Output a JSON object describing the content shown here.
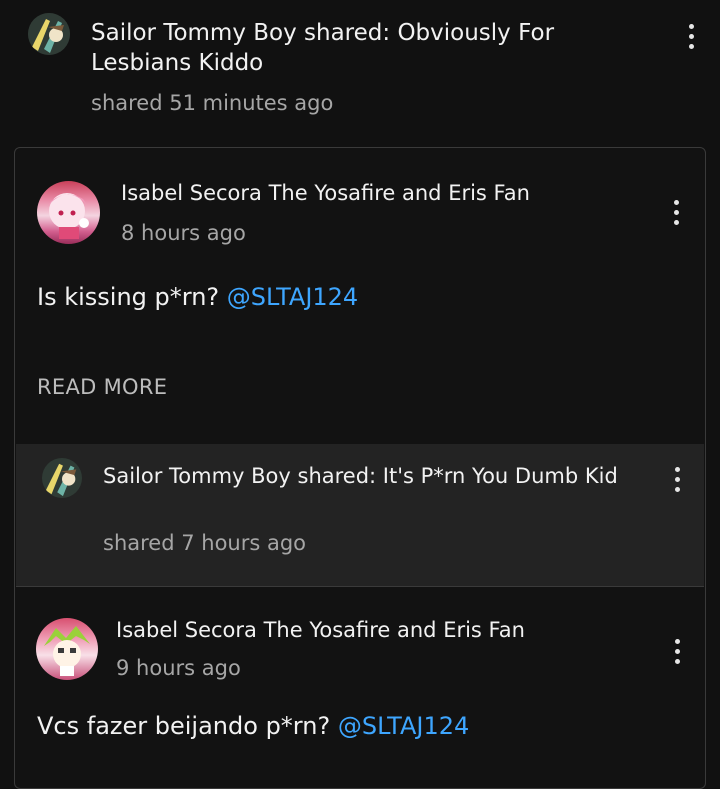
{
  "top_post": {
    "title": "Sailor Tommy Boy shared: Obviously For Lesbians Kiddo",
    "meta": "shared 51 minutes ago",
    "avatar_icon": "character-avatar-icon",
    "menu_icon": "more-vert-icon"
  },
  "comment": {
    "author": "Isabel Secora The Yosafire and Eris Fan",
    "time": "8 hours ago",
    "text": "Is kissing p*rn? ",
    "mention": "@SLTAJ124",
    "read_more": "READ MORE",
    "avatar_icon": "pink-character-avatar-icon"
  },
  "shared_post": {
    "title": "Sailor Tommy Boy shared: It's P*rn You Dumb Kid",
    "meta": "shared 7 hours ago",
    "avatar_icon": "character-avatar-icon"
  },
  "comment2": {
    "author": "Isabel Secora The Yosafire and Eris Fan",
    "time": "9 hours ago",
    "partial_text": "Vcs fazer beijando p*rn?",
    "partial_mention": "@SLTAJ124",
    "avatar_icon": "green-haired-avatar-icon"
  },
  "colors": {
    "background": "#111111",
    "card_border": "#3a3a3a",
    "shared_band": "#232323",
    "link": "#3ea6ff",
    "meta_text": "#a6a6a6"
  }
}
